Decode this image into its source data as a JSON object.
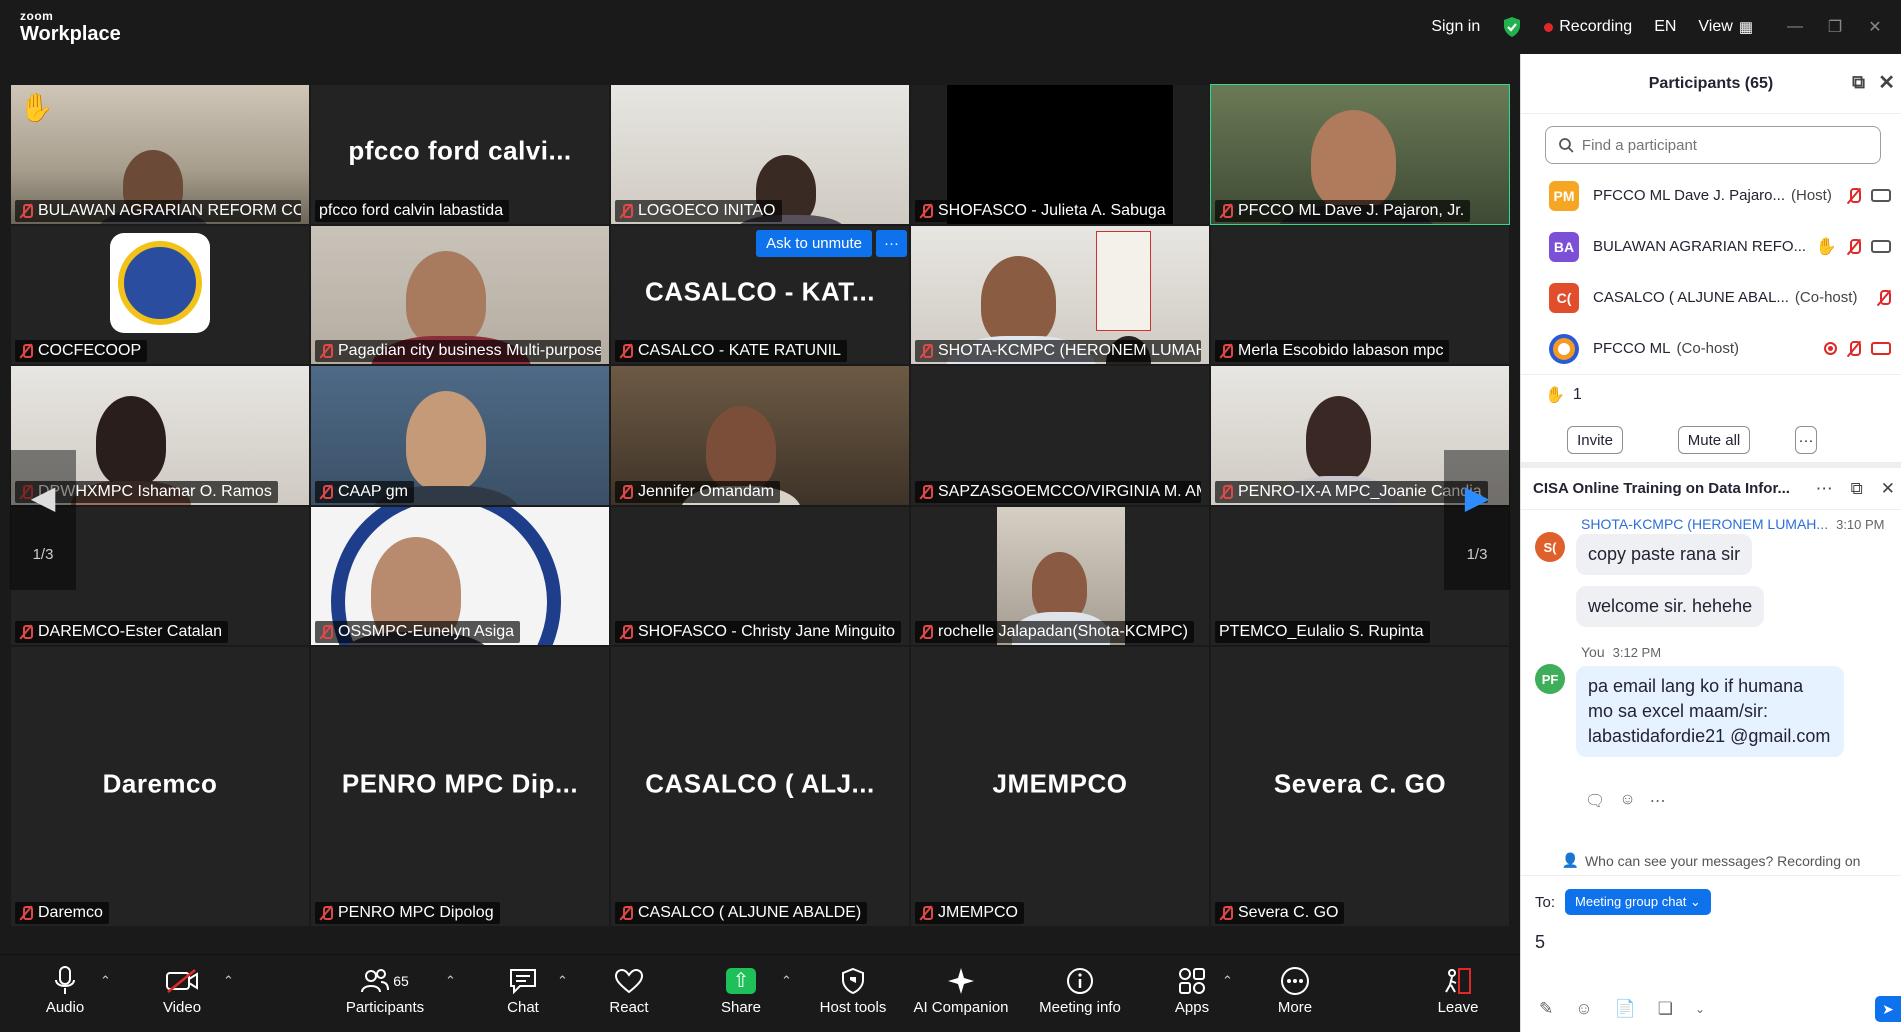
{
  "app": {
    "logo_small": "zoom",
    "logo_big": "Workplace"
  },
  "topbar": {
    "sign_in": "Sign in",
    "recording": "Recording",
    "language": "EN",
    "view": "View"
  },
  "grid": {
    "tiles": [
      {
        "label": "BULAWAN AGRARIAN REFORM COO...",
        "big": ""
      },
      {
        "label": "pfcco ford calvin labastida",
        "big": "pfcco  ford  calvi..."
      },
      {
        "label": "LOGOECO INITAO",
        "big": ""
      },
      {
        "label": "SHOFASCO - Julieta A. Sabuga",
        "big": ""
      },
      {
        "label": "PFCCO ML Dave J. Pajaron, Jr.",
        "big": ""
      },
      {
        "label": "COCFECOOP",
        "big": ""
      },
      {
        "label": "Pagadian city business Multi-purpose...",
        "big": ""
      },
      {
        "label": "CASALCO - KATE RATUNIL",
        "big": "CASALCO  -  KAT..."
      },
      {
        "label": "SHOTA-KCMPC (HERONEM LUMAHA...",
        "big": ""
      },
      {
        "label": "Merla Escobido labason mpc",
        "big": ""
      },
      {
        "label": "DPWHXMPC Ishamar O. Ramos",
        "big": ""
      },
      {
        "label": "CAAP gm",
        "big": ""
      },
      {
        "label": "Jennifer Omandam",
        "big": ""
      },
      {
        "label": "SAPZASGOEMCCO/VIRGINIA M. AM...",
        "big": ""
      },
      {
        "label": "PENRO-IX-A MPC_Joanie Candia",
        "big": ""
      },
      {
        "label": "DAREMCO-Ester Catalan",
        "big": ""
      },
      {
        "label": "OSSMPC-Eunelyn Asiga",
        "big": ""
      },
      {
        "label": "SHOFASCO - Christy Jane Minguito",
        "big": ""
      },
      {
        "label": "rochelle Jalapadan(Shota-KCMPC)",
        "big": ""
      },
      {
        "label": "PTEMCO_Eulalio S. Rupinta",
        "big": ""
      },
      {
        "label": "Daremco",
        "big": "Daremco"
      },
      {
        "label": "PENRO MPC Dipolog",
        "big": "PENRO  MPC  Dip..."
      },
      {
        "label": "CASALCO ( ALJUNE ABALDE)",
        "big": "CASALCO  (  ALJ..."
      },
      {
        "label": "JMEMPCO",
        "big": "JMEMPCO"
      },
      {
        "label": "Severa C. GO",
        "big": "Severa  C.  GO"
      }
    ],
    "ask_to_unmute": "Ask to unmute",
    "more_dots": "···",
    "page_left": "1/3",
    "page_right": "1/3"
  },
  "toolbar": {
    "audio": "Audio",
    "video": "Video",
    "participants": "Participants",
    "participant_count": "65",
    "chat": "Chat",
    "react": "React",
    "share": "Share",
    "host_tools": "Host tools",
    "ai_companion": "AI Companion",
    "meeting_info": "Meeting info",
    "apps": "Apps",
    "more": "More",
    "leave": "Leave"
  },
  "participants_panel": {
    "title": "Participants (65)",
    "search_placeholder": "Find a participant",
    "rows": [
      {
        "initials": "PM",
        "name": "PFCCO ML Dave J. Pajaro...",
        "role": "(Host)",
        "color": "#f5a623"
      },
      {
        "initials": "BA",
        "name": "BULAWAN AGRARIAN REFO...",
        "role": "",
        "color": "#7b4fd6"
      },
      {
        "initials": "C(",
        "name": "CASALCO ( ALJUNE ABAL...",
        "role": "(Co-host)",
        "color": "#e04e2b"
      },
      {
        "initials": "",
        "name": "PFCCO ML",
        "role": "(Co-host)",
        "color": "#2a5bd7"
      }
    ],
    "raised_hands": "1",
    "invite": "Invite",
    "mute_all": "Mute all",
    "more": "···"
  },
  "chat_panel": {
    "title": "CISA Online Training on Data Infor...",
    "messages": [
      {
        "sender": "SHOTA-KCMPC (HERONEM LUMAH...",
        "time": "3:10 PM",
        "avatar": "S(",
        "color": "#e0602b",
        "lines": [
          "copy paste rana sir",
          "welcome sir. hehehe"
        ]
      },
      {
        "sender": "You",
        "time": "3:12 PM",
        "avatar": "PF",
        "color": "#3fae5a",
        "text": "pa email lang ko if humana mo sa excel maam/sir: labastidafordie21 @gmail.com"
      }
    ],
    "visibility_note": "Who can see your messages? Recording on",
    "to_label": "To:",
    "to_value": "Meeting group chat",
    "draft": "5"
  }
}
